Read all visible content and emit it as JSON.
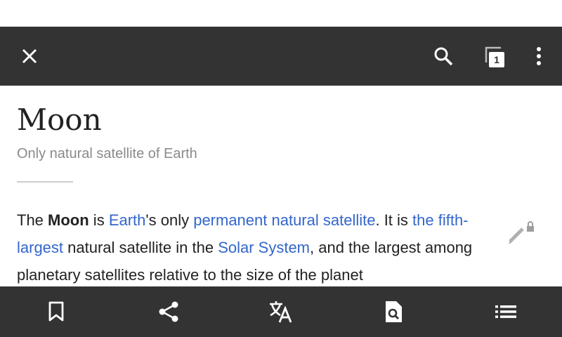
{
  "colors": {
    "toolbar_bg": "#333333",
    "link": "#3366cc",
    "progress": "#3a7bd5",
    "text": "#222222",
    "subtitle": "#8a8a8a"
  },
  "toolbar": {
    "close_icon": "close-icon",
    "search_icon": "search-icon",
    "tabs_count": "1",
    "overflow_icon": "overflow-menu-icon"
  },
  "article": {
    "title": "Moon",
    "description": "Only natural satellite of Earth",
    "lead": {
      "t1": "The ",
      "bold": "Moon",
      "t2": " is ",
      "link1": "Earth",
      "t3": "'s only ",
      "link2": "permanent natural satellite",
      "t4": ". It is ",
      "link3": "the fifth-largest",
      "t5": " natural satellite in the ",
      "link4": "Solar System",
      "t6": ", and the largest among planetary satellites relative to the size of the planet"
    },
    "edit_icon": "edit-locked-icon"
  },
  "bottom_bar": {
    "items": [
      "bookmark-icon",
      "share-icon",
      "translate-icon",
      "find-in-page-icon",
      "contents-icon"
    ]
  }
}
